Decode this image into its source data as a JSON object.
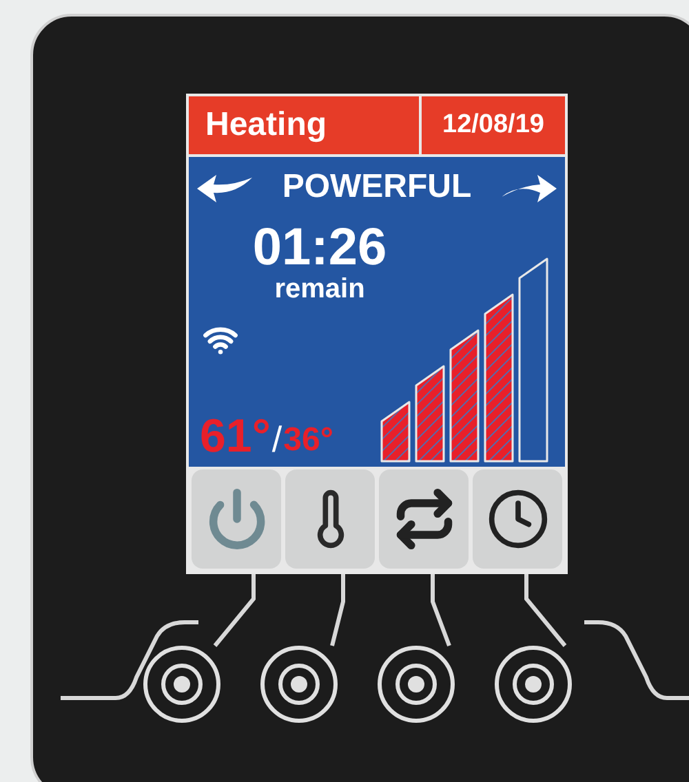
{
  "header": {
    "mode": "Heating",
    "date": "12/08/19"
  },
  "level_name": "POWERFUL",
  "timer": {
    "time": "01:26",
    "label": "remain"
  },
  "temperatures": {
    "current": "61°",
    "separator": "/",
    "target": "36°"
  },
  "power_bars": [
    {
      "on": true
    },
    {
      "on": true
    },
    {
      "on": true
    },
    {
      "on": true
    },
    {
      "on": false
    }
  ],
  "menu_tiles": [
    {
      "kind": "power"
    },
    {
      "kind": "thermometer"
    },
    {
      "kind": "swap"
    },
    {
      "kind": "clock"
    }
  ]
}
